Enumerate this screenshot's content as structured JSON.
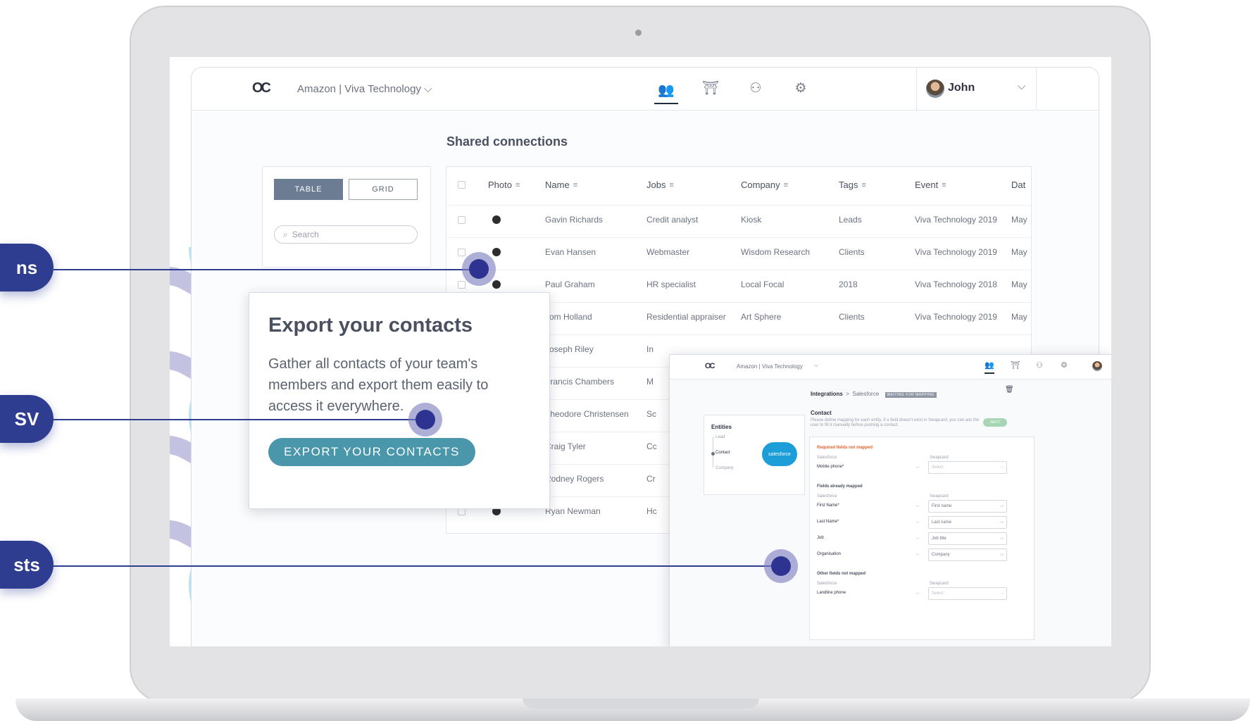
{
  "header": {
    "logo_text": "OC",
    "workspace": "Amazon | Viva Technology",
    "user_name": "John"
  },
  "page_title": "Shared connections",
  "view_toggle": {
    "table_label": "TABLE",
    "grid_label": "GRID"
  },
  "search": {
    "placeholder": "Search"
  },
  "table": {
    "columns": [
      "Photo",
      "Name",
      "Jobs",
      "Company",
      "Tags",
      "Event",
      "Dat"
    ],
    "rows": [
      {
        "name": "Gavin Richards",
        "job": "Credit analyst",
        "company": "Kiosk",
        "tags": "Leads",
        "event": "Viva Technology 2019",
        "date": "May"
      },
      {
        "name": "Evan Hansen",
        "job": "Webmaster",
        "company": "Wisdom Research",
        "tags": "Clients",
        "event": "Viva Technology 2019",
        "date": "May"
      },
      {
        "name": "Paul Graham",
        "job": "HR specialist",
        "company": "Local Focal",
        "tags": "2018",
        "event": "Viva Technology 2018",
        "date": "May"
      },
      {
        "name": "Tom Holland",
        "job": "Residential appraiser",
        "company": "Art Sphere",
        "tags": "Clients",
        "event": "Viva Technology 2019",
        "date": "May"
      },
      {
        "name": "Joseph Riley",
        "job": "In",
        "company": "",
        "tags": "",
        "event": "",
        "date": ""
      },
      {
        "name": "Francis Chambers",
        "job": "M",
        "company": "",
        "tags": "",
        "event": "",
        "date": ""
      },
      {
        "name": "Theodore Christensen",
        "job": "Sc",
        "company": "",
        "tags": "",
        "event": "",
        "date": ""
      },
      {
        "name": "Craig Tyler",
        "job": "Cc",
        "company": "",
        "tags": "",
        "event": "",
        "date": ""
      },
      {
        "name": "Rodney Rogers",
        "job": "Cr",
        "company": "",
        "tags": "",
        "event": "",
        "date": ""
      },
      {
        "name": "Ryan Newman",
        "job": "Hc",
        "company": "",
        "tags": "",
        "event": "",
        "date": ""
      }
    ]
  },
  "export_card": {
    "title": "Export your contacts",
    "body": "Gather all contacts of your team's members and export them easily to access it everywhere.",
    "button": "EXPORT YOUR CONTACTS"
  },
  "integrations": {
    "workspace": "Amazon | Viva Technology",
    "breadcrumb_root": "Integrations",
    "breadcrumb_sep": ">",
    "breadcrumb_leaf": "Salesforce",
    "status_badge": "WAITING FOR MAPPING",
    "entities_title": "Entities",
    "entities": [
      "Lead",
      "Contact",
      "Company"
    ],
    "salesforce_logo": "salesforce",
    "section_title": "Contact",
    "description": "Please define mapping for each entity. If a field doesn't exist in Swapcard, you can ask the user to fill it manually before pushing a contact.",
    "next_label": "NEXT",
    "col_left": "Salesforce",
    "col_right": "Swapcard",
    "groups": [
      {
        "title": "Required fields not mapped",
        "fields": [
          {
            "left": "Mobile phone*",
            "right": "Select"
          }
        ]
      },
      {
        "title": "Fields already mapped",
        "fields": [
          {
            "left": "First Name*",
            "right": "First name"
          },
          {
            "left": "Last Name*",
            "right": "Last name"
          },
          {
            "left": "Job",
            "right": "Job title"
          },
          {
            "left": "Organisation",
            "right": "Company"
          }
        ]
      },
      {
        "title": "Other fields not mapped",
        "fields": [
          {
            "left": "Landline phone",
            "right": "Select"
          }
        ]
      }
    ]
  },
  "callouts": [
    "ns",
    "SV",
    "sts"
  ],
  "colors": {
    "callout": "#2e3d8f",
    "export_button": "#4a97ab",
    "table_toggle_active": "#6b7c93",
    "required_text": "#e8632c",
    "next_badge": "#a8d5b3",
    "salesforce": "#1d9ed9"
  }
}
